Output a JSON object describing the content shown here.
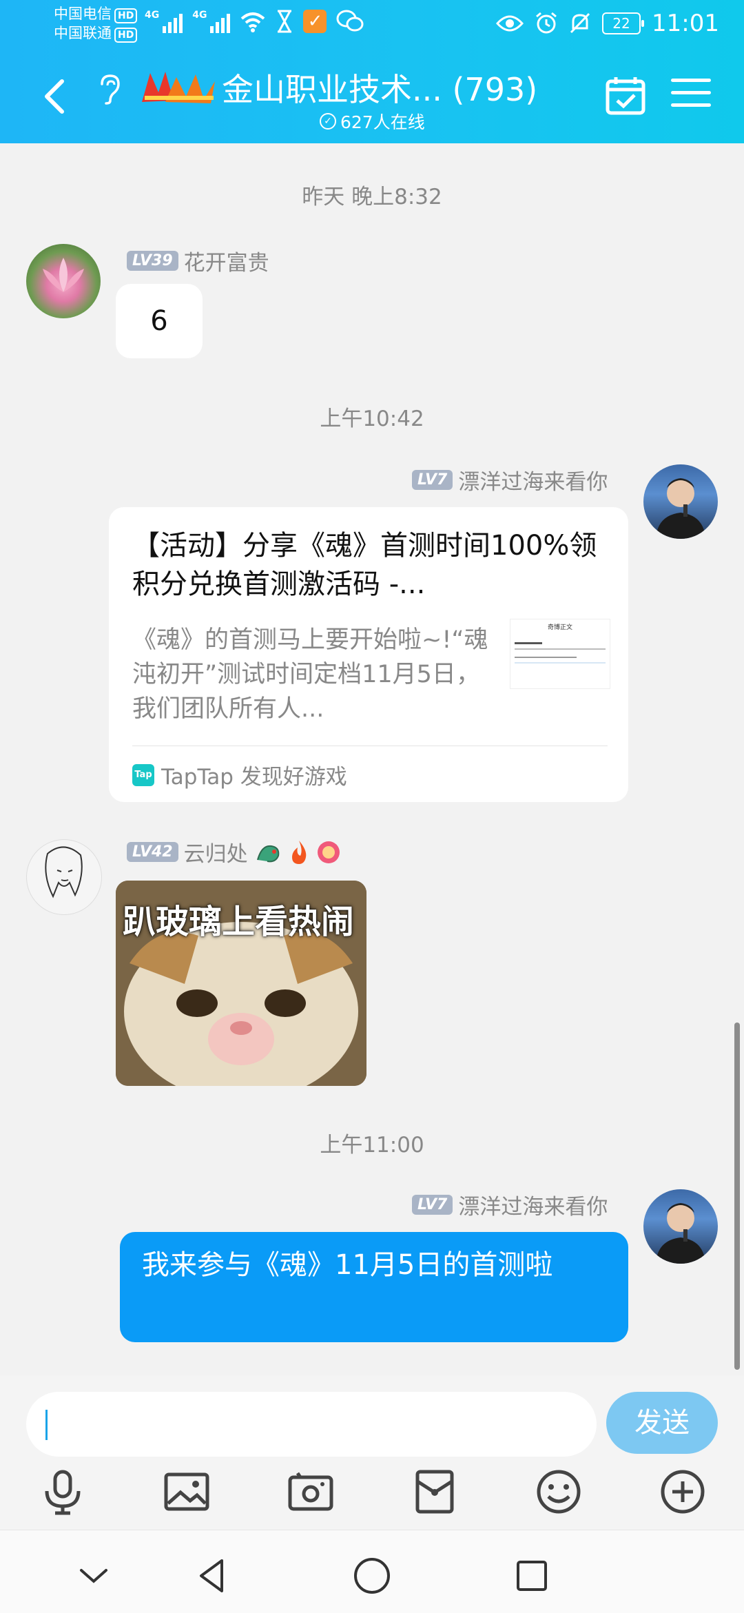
{
  "status_bar": {
    "carrier1": "中国电信",
    "carrier2": "中国联通",
    "hd": "HD",
    "net1": "4G",
    "net2": "4G",
    "battery": "22",
    "time": "11:01"
  },
  "header": {
    "title": "金山职业技术... (793)",
    "online": "627人在线"
  },
  "messages": {
    "ts1": "昨天 晚上8:32",
    "m1": {
      "level": "LV39",
      "name": "花开富贵",
      "text": "6"
    },
    "ts2": "上午10:42",
    "m2": {
      "level": "LV7",
      "name": "漂洋过海来看你",
      "title": "【活动】分享《魂》首测时间100%领积分兑换首测激活码 -...",
      "desc": "《魂》的首测马上要开始啦~!“魂沌初开”测试时间定档11月5日，我们团队所有人...",
      "source": "TapTap 发现好游戏",
      "thumb_text": "奇博正文",
      "taptap_logo": "Tap"
    },
    "m3": {
      "level": "LV42",
      "name": "云归处",
      "sticker_text": "趴玻璃上看热闹"
    },
    "ts3": "上午11:00",
    "m4": {
      "level": "LV7",
      "name": "漂洋过海来看你",
      "text": "我来参与《魂》11月5日的首测啦"
    }
  },
  "input": {
    "value": "",
    "send_label": "发送"
  },
  "colors": {
    "header": "#1eb6f6",
    "bubble_blue": "#0a9bf7",
    "send": "#7dc8f2"
  }
}
